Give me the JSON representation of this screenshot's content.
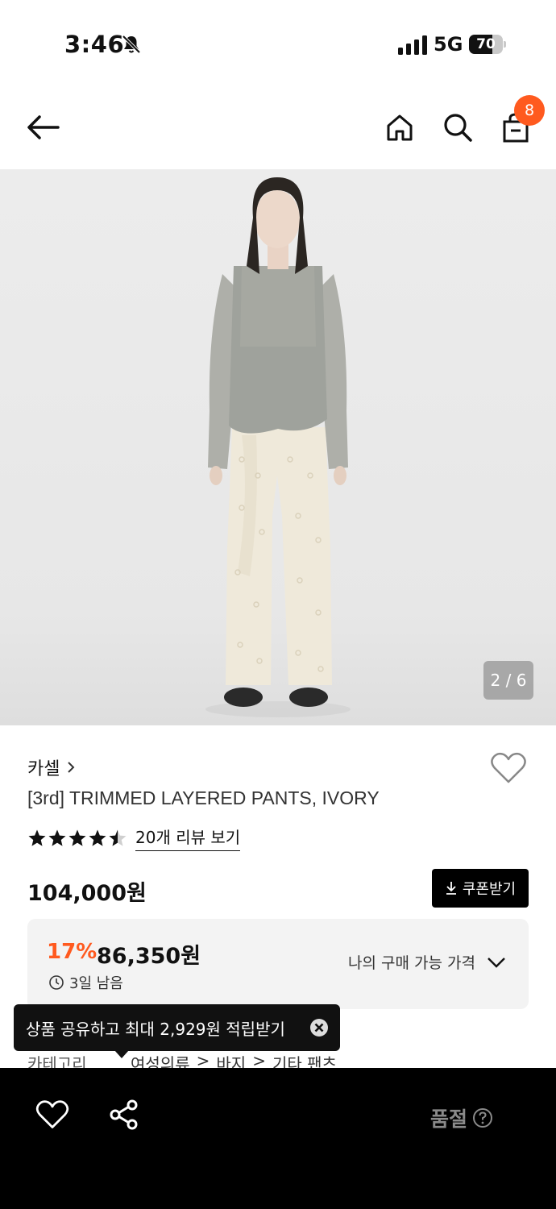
{
  "status_bar": {
    "time": "3:46",
    "network": "5G",
    "battery_percent": 70,
    "battery_label": "70"
  },
  "nav": {
    "cart_count": "8"
  },
  "gallery": {
    "counter": "2 / 6"
  },
  "product": {
    "brand": "카셀",
    "name": "[3rd] TRIMMED LAYERED PANTS, IVORY",
    "rating": 4.5,
    "review_link": "20개 리뷰 보기",
    "price": "104,000원",
    "coupon_label": "쿠폰받기"
  },
  "discount": {
    "rate": "17%",
    "price": "86,350원",
    "remaining": "3일 남음",
    "my_price_label": "나의 구매 가능 가격"
  },
  "category": {
    "label": "카테고리",
    "path": [
      "여성의류",
      "바지",
      "기타 팬츠"
    ]
  },
  "tooltip": {
    "text": "상품 공유하고 최대 2,929원 적립받기"
  },
  "bottom_bar": {
    "status": "품절"
  },
  "colors": {
    "accent": "#ff5a1f",
    "black": "#000000"
  }
}
